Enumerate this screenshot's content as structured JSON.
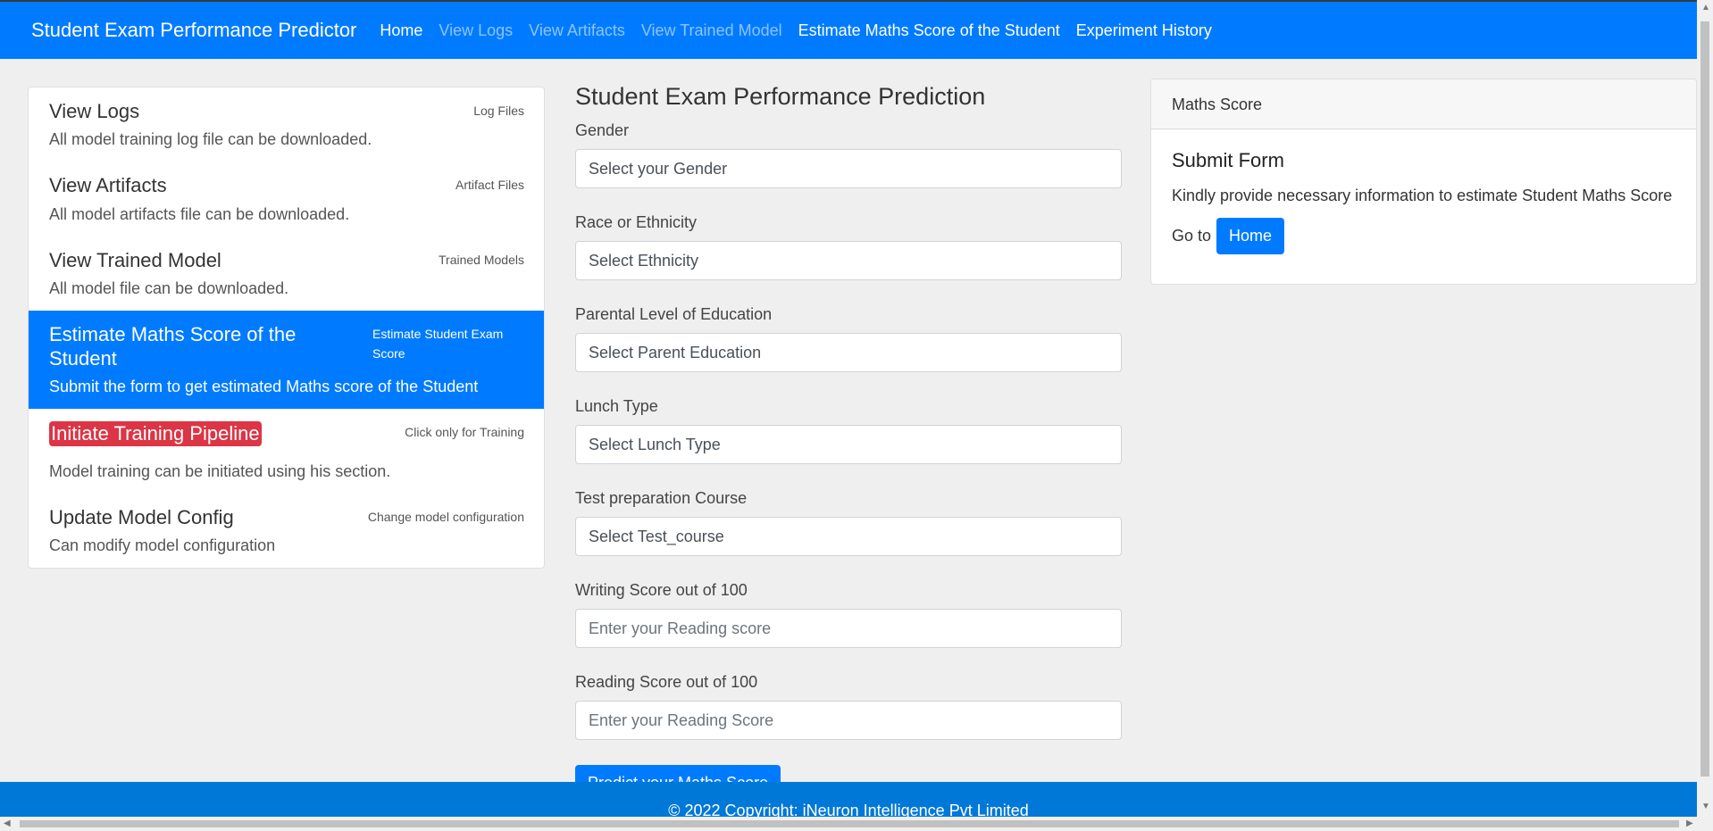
{
  "navbar": {
    "brand": "Student Exam Performance Predictor",
    "links": [
      "Home",
      "View Logs",
      "View Artifacts",
      "View Trained Model",
      "Estimate Maths Score of the Student",
      "Experiment History"
    ]
  },
  "sidebar": {
    "items": [
      {
        "title": "View Logs",
        "tag": "Log Files",
        "desc": "All model training log file can be downloaded."
      },
      {
        "title": "View Artifacts",
        "tag": "Artifact Files",
        "desc": "All model artifacts file can be downloaded."
      },
      {
        "title": "View Trained Model",
        "tag": "Trained Models",
        "desc": "All model file can be downloaded."
      },
      {
        "title": "Estimate Maths Score of the Student",
        "tag": "Estimate Student Exam Score",
        "desc": "Submit the form to get estimated Maths score of the Student"
      },
      {
        "title": "Initiate Training Pipeline",
        "tag": "Click only for Training",
        "desc": "Model training can be initiated using his section."
      },
      {
        "title": "Update Model Config",
        "tag": "Change model configuration",
        "desc": "Can modify model configuration"
      }
    ]
  },
  "form": {
    "title": "Student Exam Performance Prediction",
    "gender": {
      "label": "Gender",
      "value": "Select your Gender"
    },
    "ethnicity": {
      "label": "Race or Ethnicity",
      "value": "Select Ethnicity"
    },
    "parental": {
      "label": "Parental Level of Education",
      "value": "Select Parent Education"
    },
    "lunch": {
      "label": "Lunch Type",
      "value": "Select Lunch Type"
    },
    "test_course": {
      "label": "Test preparation Course",
      "value": "Select Test_course"
    },
    "writing": {
      "label": "Writing Score out of 100",
      "placeholder": "Enter your Reading score"
    },
    "reading": {
      "label": "Reading Score out of 100",
      "placeholder": "Enter your Reading Score"
    },
    "submit_label": "Predict your Maths Score"
  },
  "card": {
    "header": "Maths Score",
    "title": "Submit Form",
    "text": "Kindly provide necessary information to estimate Student Maths Score",
    "go_to": "Go to",
    "home_button": "Home"
  },
  "footer": {
    "text": "© 2022 Copyright: iNeuron Intelligence Pvt Limited"
  },
  "colors": {
    "primary": "#007bff",
    "danger": "#dc3545",
    "background": "#efefef"
  }
}
